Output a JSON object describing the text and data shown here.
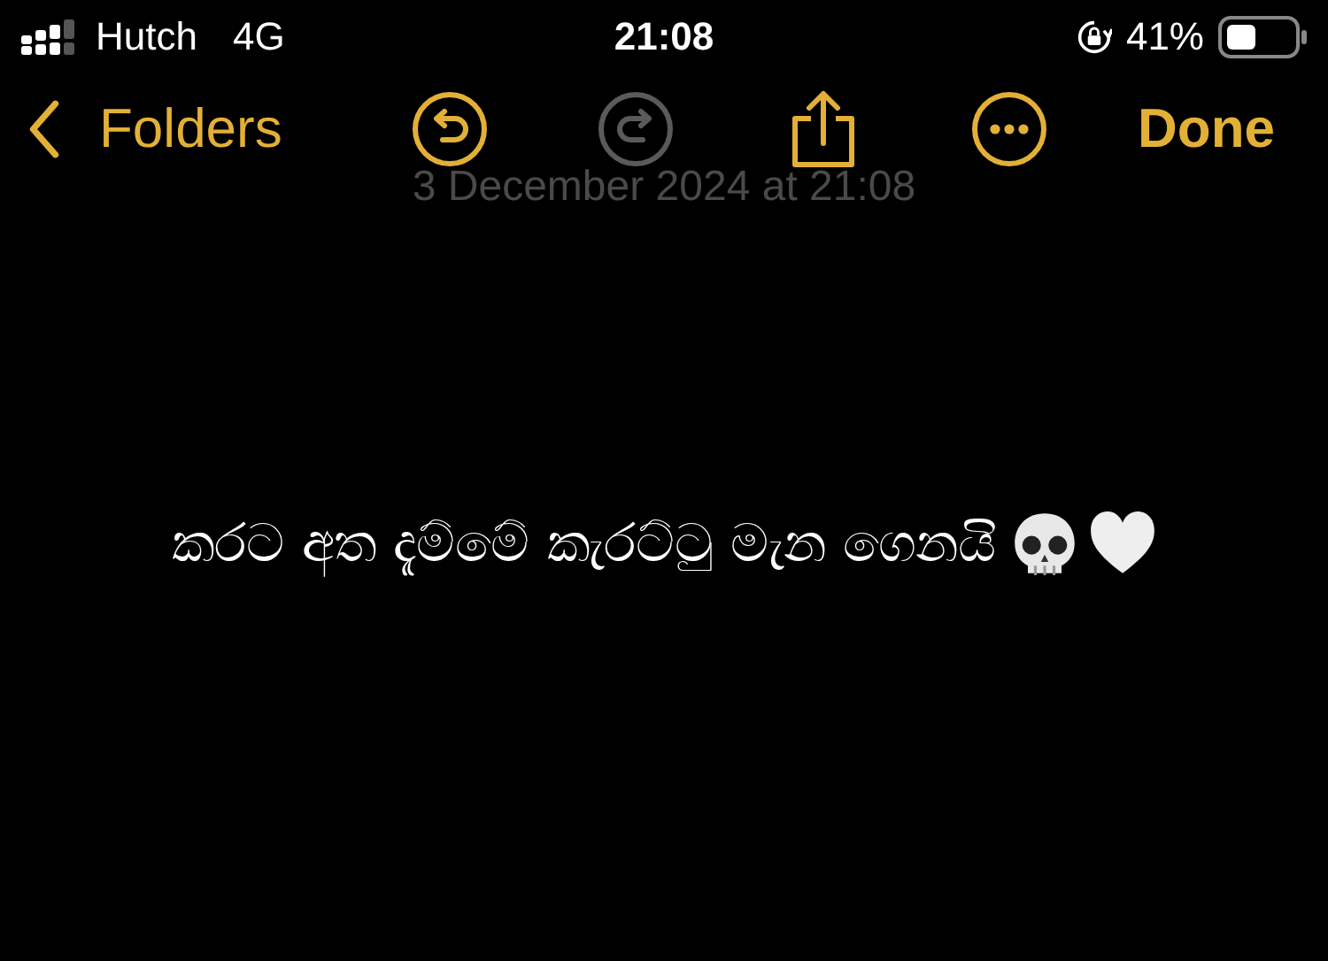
{
  "status_bar": {
    "carrier": "Hutch",
    "network": "4G",
    "time": "21:08",
    "battery_percent": "41%"
  },
  "toolbar": {
    "back_label": "Folders",
    "actions": [
      {
        "kind": "undo",
        "disabled": false
      },
      {
        "kind": "redo",
        "disabled": true
      },
      {
        "kind": "share",
        "disabled": false
      },
      {
        "kind": "more",
        "disabled": false
      }
    ],
    "done_label": "Done"
  },
  "note": {
    "date": "3 December 2024 at 21:08",
    "body": "කරට අත දැම්මේ කැරට්ටු මැන ගෙනයි",
    "emojis": [
      {
        "kind": "skull"
      },
      {
        "kind": "white-heart"
      }
    ]
  }
}
